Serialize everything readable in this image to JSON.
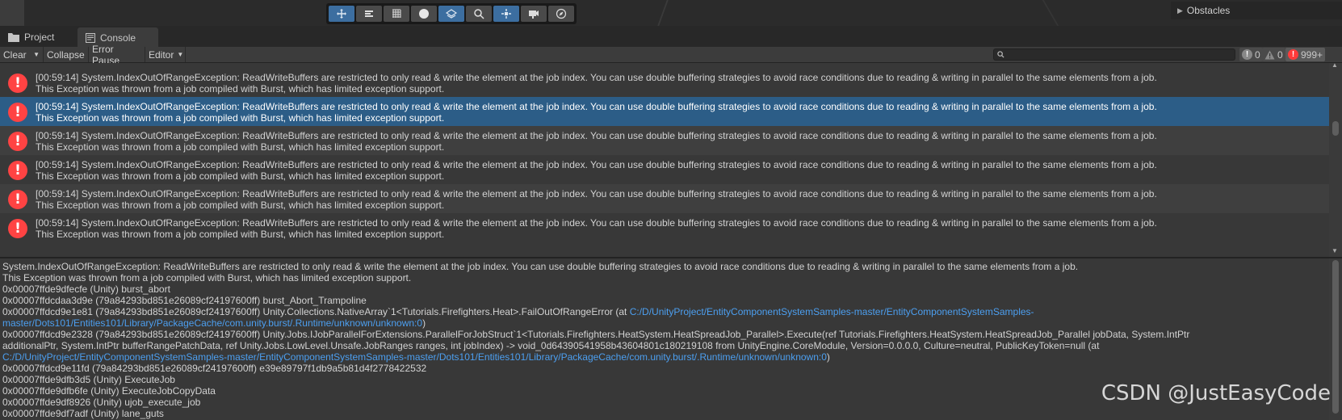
{
  "scene": {
    "hierarchy_item": "Obstacles",
    "tools": [
      {
        "icon": "move-icon",
        "active": true
      },
      {
        "icon": "rect-tool-icon",
        "active": false
      },
      {
        "icon": "grid-icon",
        "active": false
      },
      {
        "icon": "sphere-icon",
        "active": false
      },
      {
        "icon": "layers-icon",
        "active": true
      },
      {
        "icon": "search-icon",
        "active": false
      },
      {
        "icon": "transform-icon",
        "active": true
      },
      {
        "icon": "camera-icon",
        "active": false
      },
      {
        "icon": "compass-icon",
        "active": false
      }
    ]
  },
  "tabs": {
    "project": "Project",
    "console": "Console"
  },
  "toolbar": {
    "clear": "Clear",
    "collapse": "Collapse",
    "error_pause": "Error Pause",
    "editor": "Editor",
    "search_placeholder": "",
    "info_count": "0",
    "warn_count": "0",
    "error_count": "999+"
  },
  "log": {
    "line1": "[00:59:14] System.IndexOutOfRangeException: ReadWriteBuffers are restricted to only read & write the element at the job index. You can use double buffering strategies to avoid race conditions due to reading & writing in parallel to the same elements from a job.",
    "line2": "This Exception was thrown from a job compiled with Burst, which has limited exception support.",
    "selected_index": 1,
    "count": 6
  },
  "detail": {
    "lines": [
      {
        "text": "System.IndexOutOfRangeException: ReadWriteBuffers are restricted to only read & write the element at the job index. You can use double buffering strategies to avoid race conditions due to reading & writing in parallel to the same elements from a job."
      },
      {
        "text": "This Exception was thrown from a job compiled with Burst, which has limited exception support."
      },
      {
        "text": "0x00007ffde9dfecfe (Unity) burst_abort"
      },
      {
        "text": "0x00007ffdcdaa3d9e (79a84293bd851e26089cf24197600ff) burst_Abort_Trampoline"
      },
      {
        "text": "0x00007ffdcd9e1e81 (79a84293bd851e26089cf24197600ff) Unity.Collections.NativeArray`1<Tutorials.Firefighters.Heat>.FailOutOfRangeError (at ",
        "link": "C:/D/UnityProject/EntityComponentSystemSamples-master/EntityComponentSystemSamples-"
      },
      {
        "text": "",
        "link": "master/Dots101/Entities101/Library/PackageCache/com.unity.burst/.Runtime/unknown/unknown:0",
        "tail": ")"
      },
      {
        "text": "0x00007ffdcd9e2328 (79a84293bd851e26089cf24197600ff) Unity.Jobs.IJobParallelForExtensions.ParallelForJobStruct`1<Tutorials.Firefighters.HeatSystem.HeatSpreadJob_Parallel>.Execute(ref Tutorials.Firefighters.HeatSystem.HeatSpreadJob_Parallel jobData, System.IntPtr"
      },
      {
        "text": "additionalPtr, System.IntPtr bufferRangePatchData, ref Unity.Jobs.LowLevel.Unsafe.JobRanges ranges, int jobIndex) -> void_0d64390541958b43604801c180219108 from UnityEngine.CoreModule, Version=0.0.0.0, Culture=neutral, PublicKeyToken=null (at"
      },
      {
        "text": "",
        "link": "C:/D/UnityProject/EntityComponentSystemSamples-master/EntityComponentSystemSamples-master/Dots101/Entities101/Library/PackageCache/com.unity.burst/.Runtime/unknown/unknown:0",
        "tail": ")"
      },
      {
        "text": "0x00007ffdcd9e11fd (79a84293bd851e26089cf24197600ff) e39e89797f1db9a5b81d4f2778422532"
      },
      {
        "text": "0x00007ffde9dfb3d5 (Unity) ExecuteJob"
      },
      {
        "text": "0x00007ffde9dfb6fe (Unity) ExecuteJobCopyData"
      },
      {
        "text": "0x00007ffde9df8926 (Unity) ujob_execute_job"
      },
      {
        "text": "0x00007ffde9df7adf (Unity) lane_guts"
      }
    ]
  },
  "watermark": "CSDN @JustEasyCode"
}
